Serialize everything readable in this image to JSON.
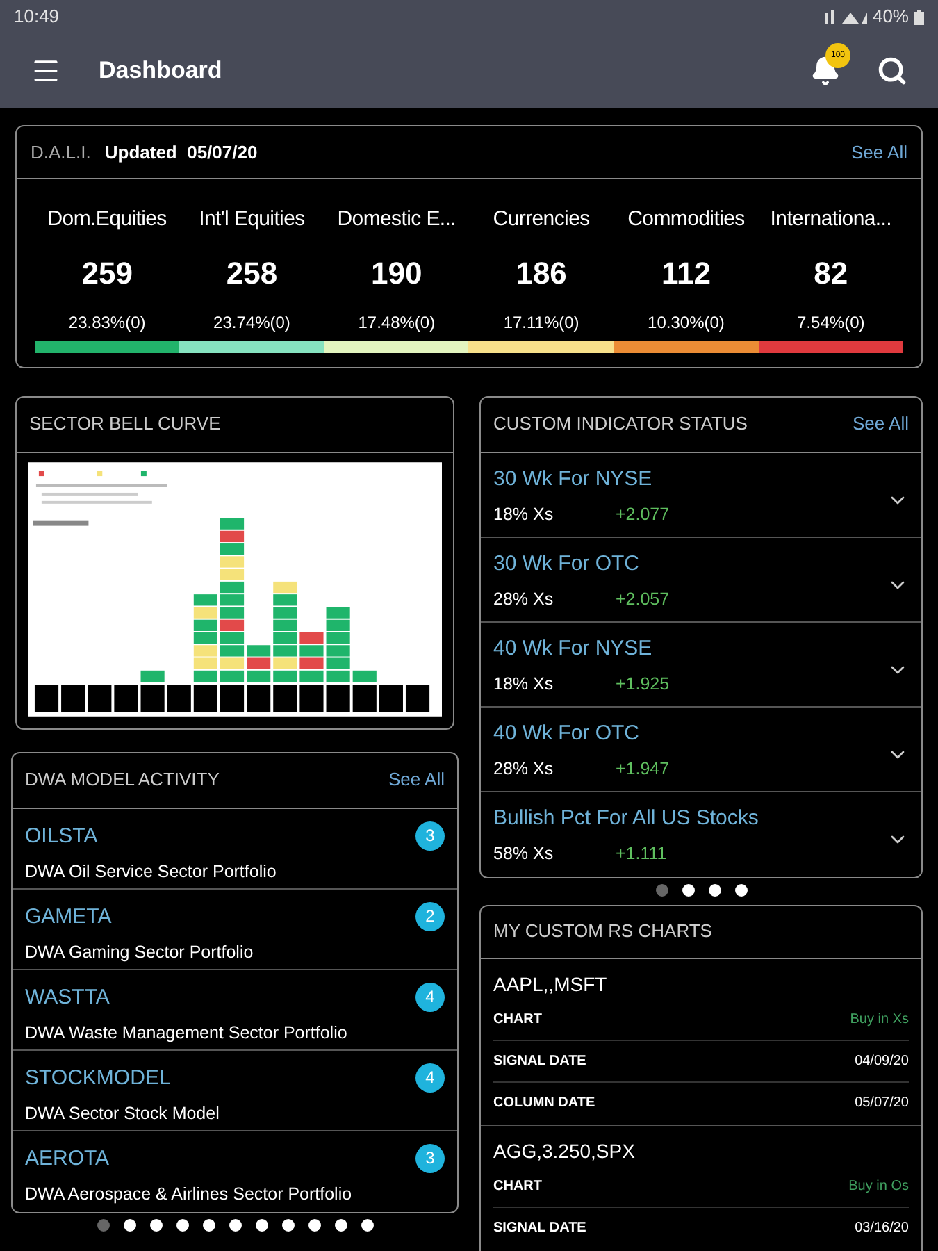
{
  "status_bar": {
    "time": "10:49",
    "battery": "40%"
  },
  "app_bar": {
    "title": "Dashboard",
    "notification_count": "100"
  },
  "dali": {
    "label": "D.A.L.I.",
    "updated": "Updated  05/07/20",
    "see_all": "See All",
    "categories": [
      {
        "name": "Dom.Equities",
        "count": "259",
        "percent": "23.83%(0)",
        "color": "#22b36b"
      },
      {
        "name": "Int'l Equities",
        "count": "258",
        "percent": "23.74%(0)",
        "color": "#86e3c0"
      },
      {
        "name": "Domestic E...",
        "count": "190",
        "percent": "17.48%(0)",
        "color": "#e3f5bf"
      },
      {
        "name": "Currencies",
        "count": "186",
        "percent": "17.11%(0)",
        "color": "#f7e08a"
      },
      {
        "name": "Commodities",
        "count": "112",
        "percent": "10.30%(0)",
        "color": "#eb8c35"
      },
      {
        "name": "Internationa...",
        "count": "82",
        "percent": "7.54%(0)",
        "color": "#e03a3e"
      }
    ]
  },
  "sector_bell_curve": {
    "title": "SECTOR BELL CURVE"
  },
  "dwa_model_activity": {
    "title": "DWA MODEL ACTIVITY",
    "see_all": "See All",
    "items": [
      {
        "code": "OILSTA",
        "name": "DWA Oil Service Sector Portfolio",
        "count": "3"
      },
      {
        "code": "GAMETA",
        "name": "DWA Gaming Sector Portfolio",
        "count": "2"
      },
      {
        "code": "WASTTA",
        "name": "DWA Waste Management Sector Portfolio",
        "count": "4"
      },
      {
        "code": "STOCKMODEL",
        "name": "DWA Sector Stock Model",
        "count": "4"
      },
      {
        "code": "AEROTA",
        "name": "DWA Aerospace & Airlines Sector Portfolio",
        "count": "3"
      }
    ],
    "pages": [
      {
        "selected": true
      },
      {
        "selected": false
      },
      {
        "selected": false
      },
      {
        "selected": false
      },
      {
        "selected": false
      },
      {
        "selected": false
      },
      {
        "selected": false
      },
      {
        "selected": false
      },
      {
        "selected": false
      },
      {
        "selected": false
      },
      {
        "selected": false
      }
    ]
  },
  "custom_indicator_status": {
    "title": "CUSTOM INDICATOR STATUS",
    "see_all": "See All",
    "items": [
      {
        "name": "30 Wk For NYSE",
        "status": "18% Xs",
        "change": "+2.077"
      },
      {
        "name": "30 Wk For OTC",
        "status": "28% Xs",
        "change": "+2.057"
      },
      {
        "name": "40 Wk For NYSE",
        "status": "18% Xs",
        "change": "+1.925"
      },
      {
        "name": "40 Wk For OTC",
        "status": "28% Xs",
        "change": "+1.947"
      },
      {
        "name": "Bullish Pct For All US Stocks",
        "status": "58% Xs",
        "change": "+1.111"
      }
    ],
    "pages": [
      {
        "selected": true
      },
      {
        "selected": false
      },
      {
        "selected": false
      },
      {
        "selected": false
      }
    ]
  },
  "my_custom_rs_charts": {
    "title": "MY CUSTOM RS CHARTS",
    "charts": [
      {
        "name": "AAPL,,MSFT",
        "rows": [
          {
            "label": "CHART",
            "value": "Buy in Xs",
            "kind": "signal"
          },
          {
            "label": "SIGNAL DATE",
            "value": "04/09/20",
            "kind": "date"
          },
          {
            "label": "COLUMN DATE",
            "value": "05/07/20",
            "kind": "date"
          }
        ]
      },
      {
        "name": "AGG,3.250,SPX",
        "rows": [
          {
            "label": "CHART",
            "value": "Buy in Os",
            "kind": "signal"
          },
          {
            "label": "SIGNAL DATE",
            "value": "03/16/20",
            "kind": "date"
          }
        ]
      }
    ]
  }
}
